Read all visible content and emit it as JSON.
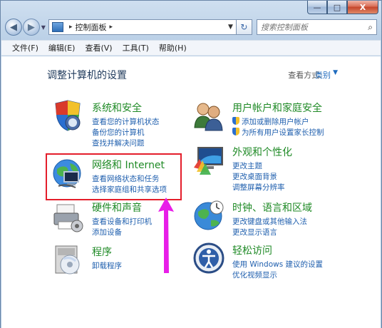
{
  "titlebar": {
    "minimize_glyph": "—",
    "maximize_glyph": "□",
    "close_glyph": "X"
  },
  "address": {
    "path_root_arrow": "▸",
    "path": "控制面板",
    "path_end_arrow": "▸"
  },
  "search": {
    "placeholder": "搜索控制面板"
  },
  "menu": [
    "文件(F)",
    "编辑(E)",
    "查看(V)",
    "工具(T)",
    "帮助(H)"
  ],
  "page": {
    "heading": "调整计算机的设置",
    "view_by_label": "查看方式:",
    "view_by_value": "类别"
  },
  "categories": [
    {
      "title": "系统和安全",
      "links": [
        "查看您的计算机状态",
        "备份您的计算机",
        "查找并解决问题"
      ],
      "icon": "shield-icon"
    },
    {
      "title": "网络和 Internet",
      "links": [
        "查看网络状态和任务",
        "选择家庭组和共享选项"
      ],
      "icon": "network-globe-icon"
    },
    {
      "title": "硬件和声音",
      "links": [
        "查看设备和打印机",
        "添加设备"
      ],
      "icon": "printer-icon"
    },
    {
      "title": "程序",
      "links": [
        "卸载程序"
      ],
      "icon": "programs-disk-icon"
    },
    {
      "title": "用户帐户和家庭安全",
      "links": [
        "添加或删除用户帐户",
        "为所有用户设置家长控制"
      ],
      "icon": "users-icon"
    },
    {
      "title": "外观和个性化",
      "links": [
        "更改主题",
        "更改桌面背景",
        "调整屏幕分辨率"
      ],
      "icon": "monitor-palette-icon"
    },
    {
      "title": "时钟、语言和区域",
      "links": [
        "更改键盘或其他输入法",
        "更改显示语言"
      ],
      "icon": "clock-globe-icon"
    },
    {
      "title": "轻松访问",
      "links": [
        "使用 Windows 建议的设置",
        "优化视频显示"
      ],
      "icon": "ease-of-access-icon"
    }
  ],
  "colors": {
    "category_title": "#1f8a26",
    "link": "#1f5fae",
    "highlight_box": "#e41e2b",
    "annotation_arrow": "#e81ee8"
  }
}
